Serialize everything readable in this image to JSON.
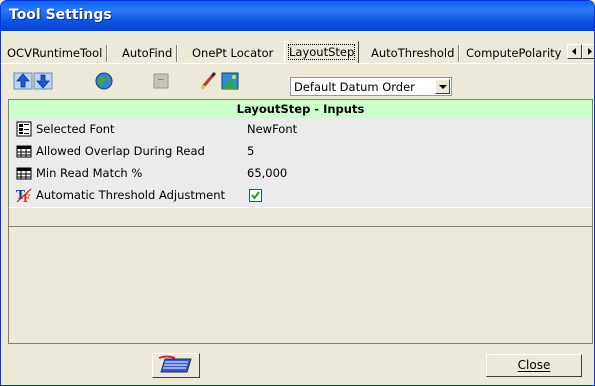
{
  "window": {
    "title": "Tool Settings"
  },
  "tabs": [
    {
      "label": "OCVRuntimeTool"
    },
    {
      "label": "AutoFind"
    },
    {
      "label": "OnePt Locator"
    },
    {
      "label": "LayoutStep"
    },
    {
      "label": "AutoThreshold"
    },
    {
      "label": "ComputePolarity"
    }
  ],
  "active_tab": "LayoutStep",
  "toolbar": {
    "icons": [
      "move-up-icon",
      "move-down-icon",
      "globe-icon",
      "disabled-icon",
      "brush-icon",
      "image-icon"
    ],
    "datum_order": {
      "selected": "Default Datum Order"
    }
  },
  "grid": {
    "header": "LayoutStep - Inputs",
    "rows": [
      {
        "label": "Selected Font",
        "value": "NewFont",
        "icon": "font-list-icon"
      },
      {
        "label": "Allowed Overlap During Read",
        "value": "5",
        "icon": "grid-table-icon"
      },
      {
        "label": "Min Read Match %",
        "value": "65,000",
        "icon": "grid-table-icon"
      },
      {
        "label": "Automatic Threshold Adjustment",
        "value": "",
        "checked": true,
        "icon": "threshold-tf-icon"
      }
    ]
  },
  "buttons": {
    "close": "Close"
  }
}
